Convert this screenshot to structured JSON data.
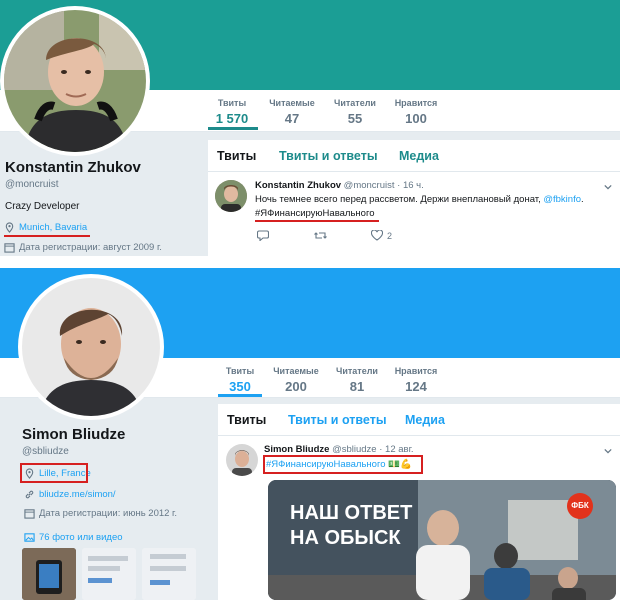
{
  "profiles": [
    {
      "name": "Konstantin Zhukov",
      "handle": "@moncruist",
      "bio": "Crazy Developer",
      "location": "Munich, Bavaria",
      "joined": "Дата регистрации: август 2009 г.",
      "banner_color": "#1b9e95",
      "stats": [
        {
          "label": "Твиты",
          "value": "1 570"
        },
        {
          "label": "Читаемые",
          "value": "47"
        },
        {
          "label": "Читатели",
          "value": "55"
        },
        {
          "label": "Нравится",
          "value": "100"
        }
      ],
      "tabs": [
        "Твиты",
        "Твиты и ответы",
        "Медиа"
      ],
      "tweet": {
        "author": "Konstantin Zhukov",
        "handle": "@moncruist",
        "time": "· 16 ч.",
        "text": "Ночь темнее всего перед рассветом. Держи внеплановый донат,",
        "mention": "@fbkinfo",
        "text_end": ".",
        "hashtag": "#ЯФинансируюНавального",
        "likes": "2"
      }
    },
    {
      "name": "Simon Bliudze",
      "handle": "@sbliudze",
      "location": "Lille, France",
      "website": "bliudze.me/simon/",
      "joined": "Дата регистрации: июнь 2012 г.",
      "photos": "76 фото или видео",
      "banner_color": "#1da1f2",
      "stats": [
        {
          "label": "Твиты",
          "value": "350"
        },
        {
          "label": "Читаемые",
          "value": "200"
        },
        {
          "label": "Читатели",
          "value": "81"
        },
        {
          "label": "Нравится",
          "value": "124"
        }
      ],
      "tabs": [
        "Твиты",
        "Твиты и ответы",
        "Медиа"
      ],
      "tweet": {
        "author": "Simon Bliudze",
        "handle": "@sbliudze",
        "time": "· 12 авг.",
        "hashtag": "#ЯФинансируюНавального",
        "emoji": "💵💪",
        "image_badge": "ФБК",
        "image_line1": "НАШ ОТВЕТ",
        "image_line2": "НА ОБЫСК"
      }
    }
  ],
  "colors": {
    "accent_teal": "#1d8b8b",
    "accent_blue": "#1da1f2",
    "highlight_red": "#d62020"
  }
}
